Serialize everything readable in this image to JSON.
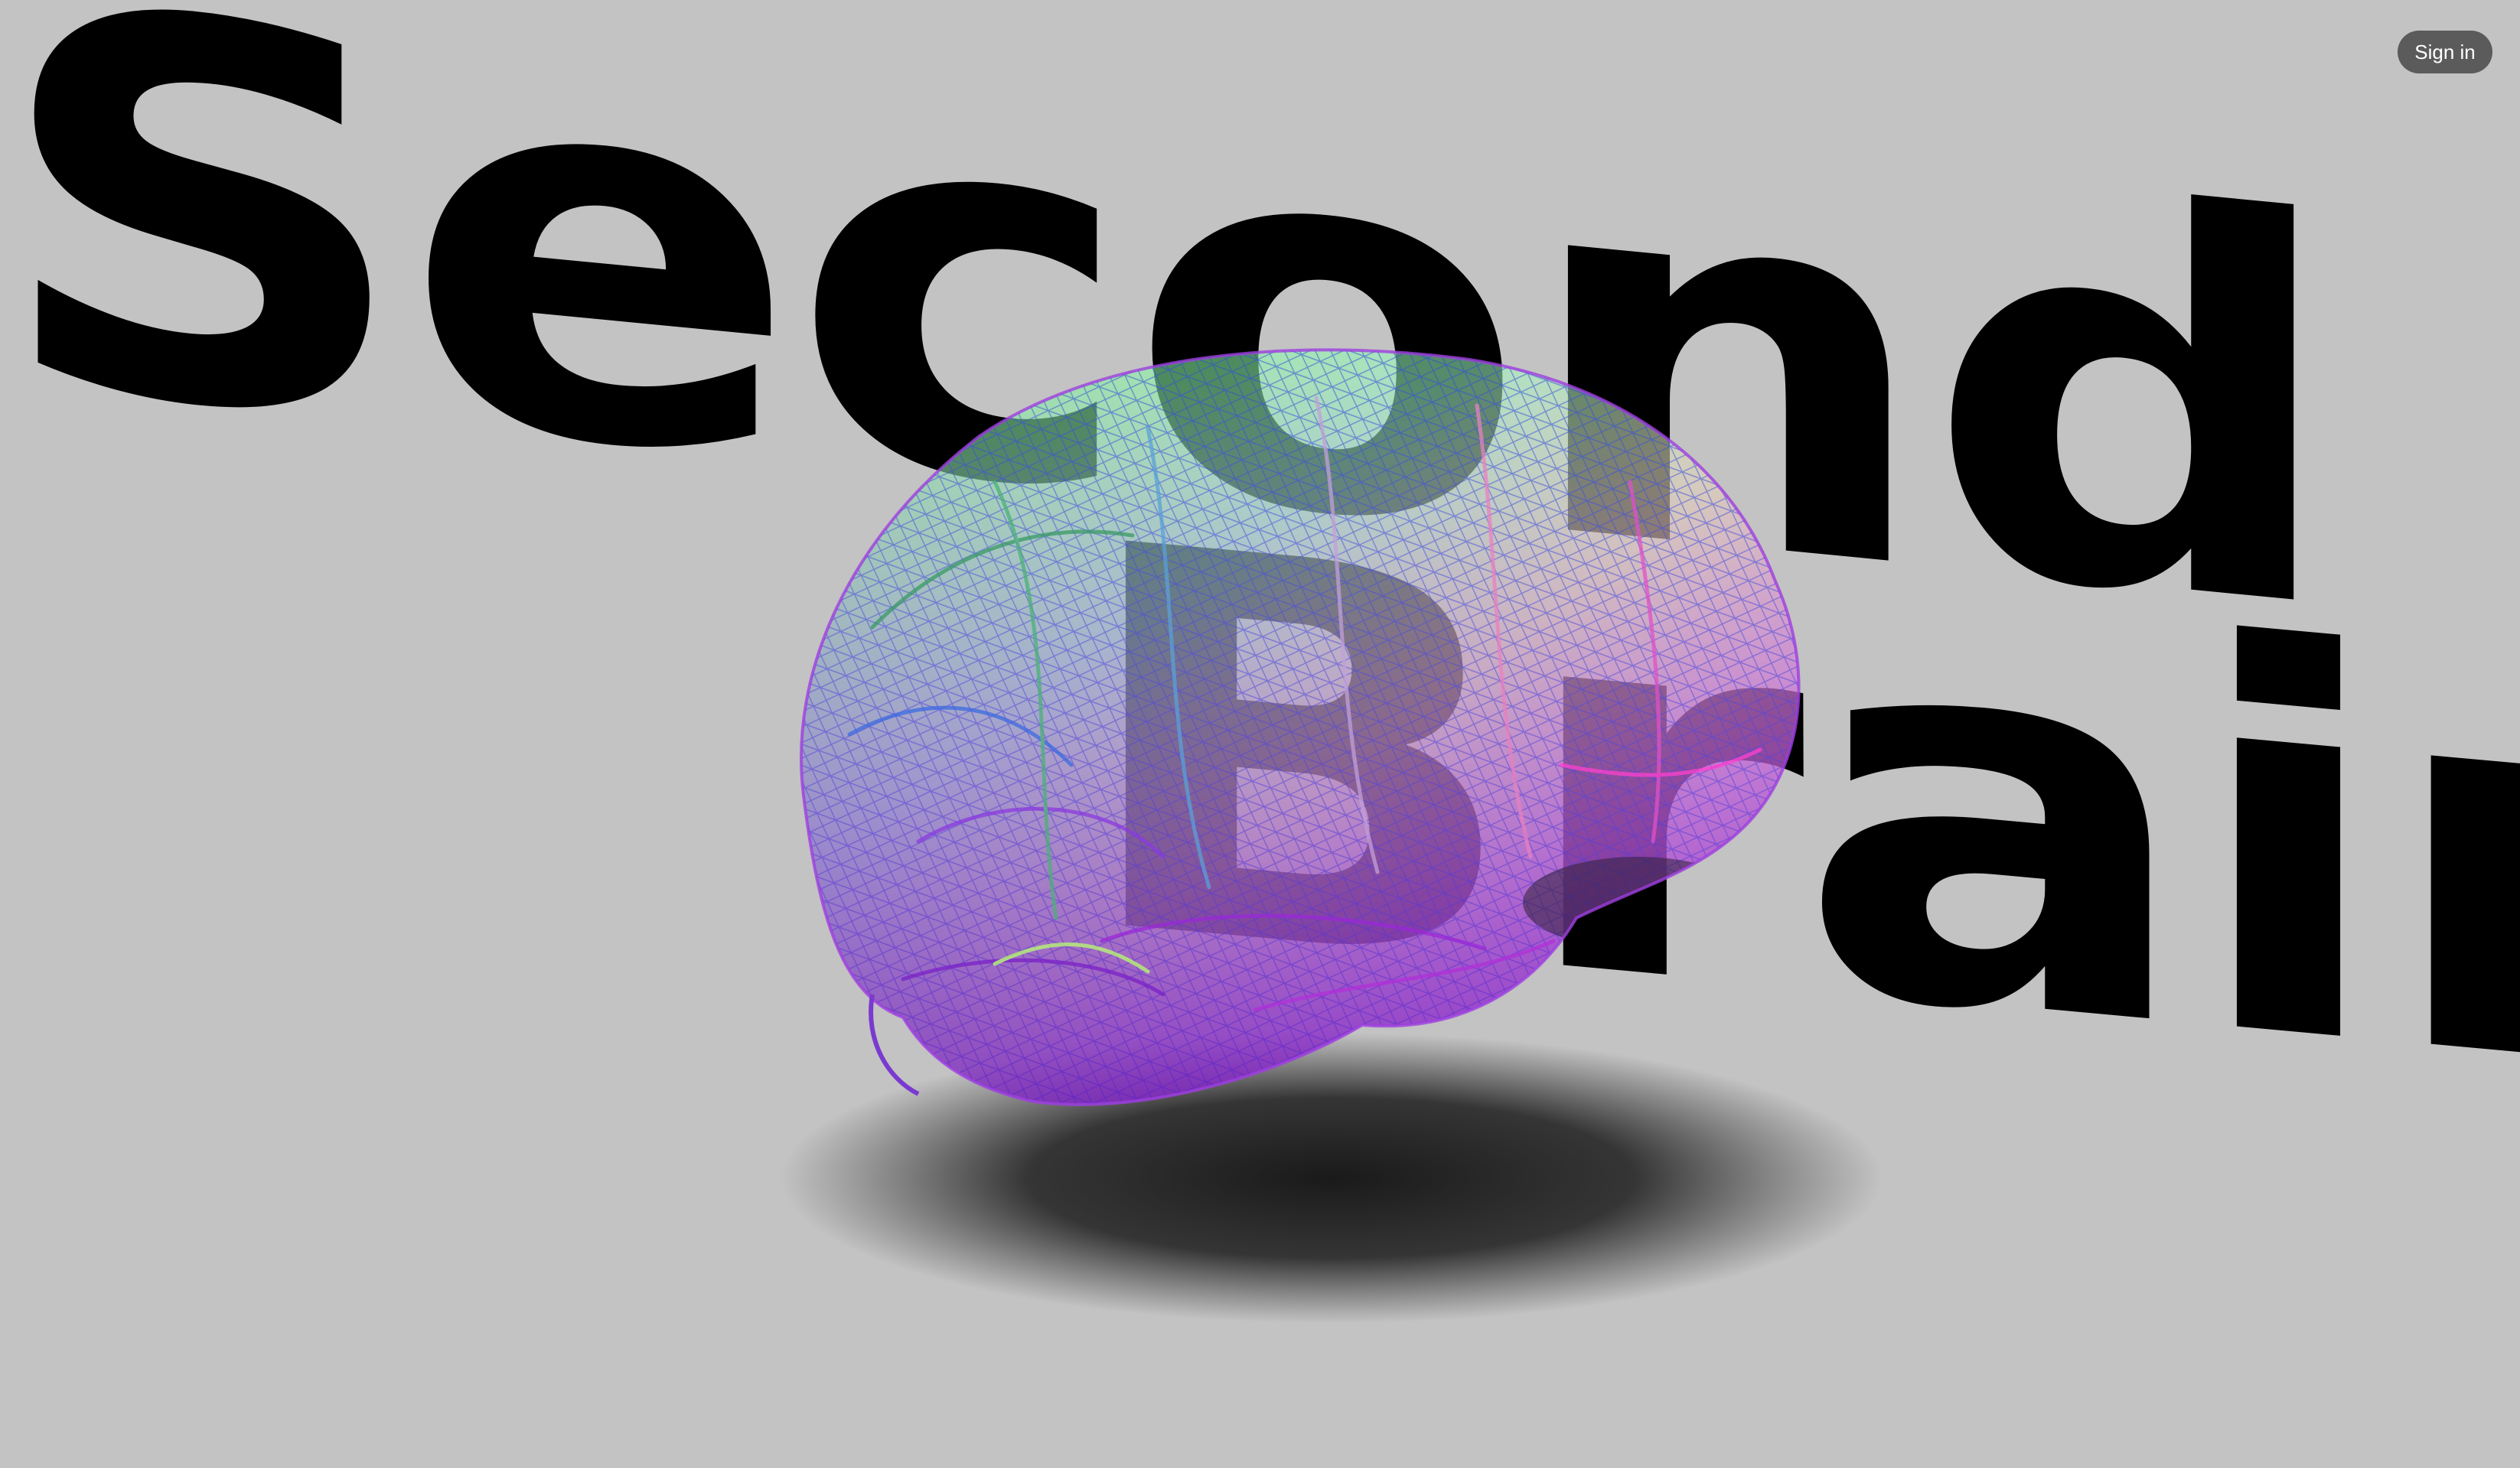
{
  "hero": {
    "title_line1": "Second",
    "title_line2": "Brain"
  },
  "header": {
    "signin_label": "Sign in"
  },
  "brain": {
    "icon": "wireframe-brain-3d",
    "colors": {
      "green": "#7dff6a",
      "blue": "#3f6fe8",
      "purple": "#8a2be2",
      "magenta": "#ff2fd8",
      "shadow": "#111111",
      "background": "#c3c3c3"
    }
  }
}
